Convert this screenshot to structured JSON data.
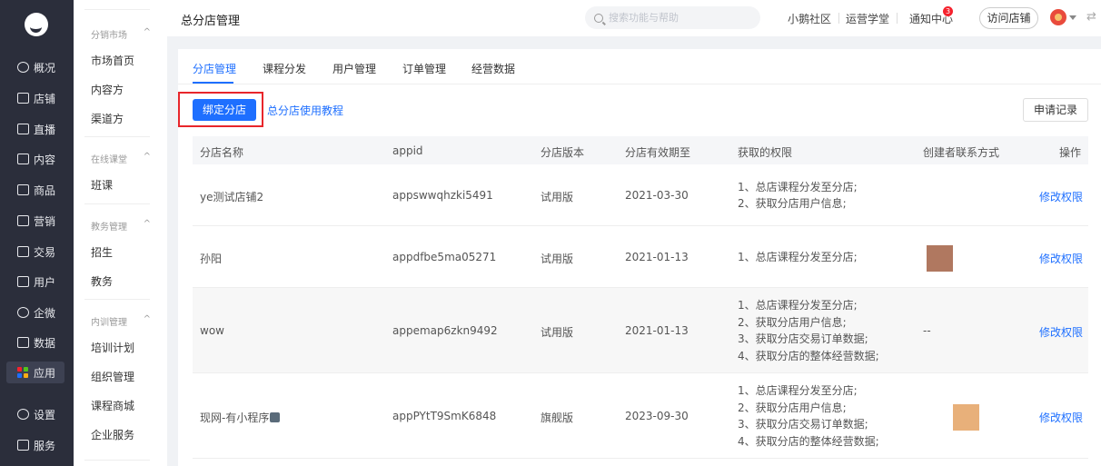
{
  "nav": {
    "items": [
      {
        "label": "概况",
        "icon": "overview-icon"
      },
      {
        "label": "店铺",
        "icon": "store-icon"
      },
      {
        "label": "直播",
        "icon": "live-icon"
      },
      {
        "label": "内容",
        "icon": "content-icon"
      },
      {
        "label": "商品",
        "icon": "goods-icon"
      },
      {
        "label": "营销",
        "icon": "marketing-icon"
      },
      {
        "label": "交易",
        "icon": "trade-icon"
      },
      {
        "label": "用户",
        "icon": "user-icon"
      },
      {
        "label": "企微",
        "icon": "wecom-icon"
      },
      {
        "label": "数据",
        "icon": "data-icon"
      },
      {
        "label": "应用",
        "icon": "apps-icon"
      },
      {
        "label": "设置",
        "icon": "settings-icon"
      },
      {
        "label": "服务",
        "icon": "service-icon"
      }
    ],
    "active": "应用",
    "apps_icon_colors": [
      "#f5222d",
      "#52c41a",
      "#1e6fff",
      "#faad14"
    ]
  },
  "subnav": {
    "groups": [
      {
        "title": "分销市场",
        "items": [
          "市场首页",
          "内容方",
          "渠道方"
        ]
      },
      {
        "title": "在线课堂",
        "items": [
          "班课"
        ]
      },
      {
        "title": "教务管理",
        "items": [
          "招生",
          "教务"
        ]
      },
      {
        "title": "内训管理",
        "items": [
          "培训计划",
          "组织管理",
          "课程商城",
          "企业服务"
        ]
      }
    ],
    "collapse_glyph": "^"
  },
  "header": {
    "title": "总分店管理",
    "search_placeholder": "搜索功能与帮助",
    "links": [
      "小鹅社区",
      "运营学堂",
      "通知中心"
    ],
    "notification_count": "3",
    "visit_store": "访问店铺",
    "swap_glyph": "⇄"
  },
  "tabs": {
    "items": [
      "分店管理",
      "课程分发",
      "用户管理",
      "订单管理",
      "经营数据"
    ],
    "active": "分店管理"
  },
  "toolbar": {
    "bind_label": "绑定分店",
    "tutorial_label": "总分店使用教程",
    "apply_records_label": "申请记录"
  },
  "table": {
    "columns": [
      "分店名称",
      "appid",
      "分店版本",
      "分店有效期至",
      "获取的权限",
      "创建者联系方式",
      "操作"
    ],
    "rows": [
      {
        "name": "ye测试店铺2",
        "appid": "appswwqhzki5491",
        "version": "试用版",
        "expire": "2021-03-30",
        "permissions": [
          "1、总店课程分发至分店;",
          "2、获取分店用户信息;"
        ],
        "contact": "",
        "contact_thumb_color": "",
        "action": "修改权限"
      },
      {
        "name": "孙阳",
        "appid": "appdfbe5ma05271",
        "version": "试用版",
        "expire": "2021-01-13",
        "permissions": [
          "1、总店课程分发至分店;"
        ],
        "contact": "",
        "contact_thumb_color": "#b07860",
        "action": "修改权限"
      },
      {
        "name": "wow",
        "appid": "appemap6zkn9492",
        "version": "试用版",
        "expire": "2021-01-13",
        "permissions": [
          "1、总店课程分发至分店;",
          "2、获取分店用户信息;",
          "3、获取分店交易订单数据;",
          "4、获取分店的整体经营数据;"
        ],
        "contact": "--",
        "contact_thumb_color": "",
        "action": "修改权限"
      },
      {
        "name": "现网-有小程序",
        "appid": "appPYtT9SmK6848",
        "version": "旗舰版",
        "expire": "2023-09-30",
        "permissions": [
          "1、总店课程分发至分店;",
          "2、获取分店用户信息;",
          "3、获取分店交易订单数据;",
          "4、获取分店的整体经营数据;"
        ],
        "contact": "",
        "contact_thumb_color": "#e8b07a",
        "action": "修改权限"
      }
    ]
  }
}
